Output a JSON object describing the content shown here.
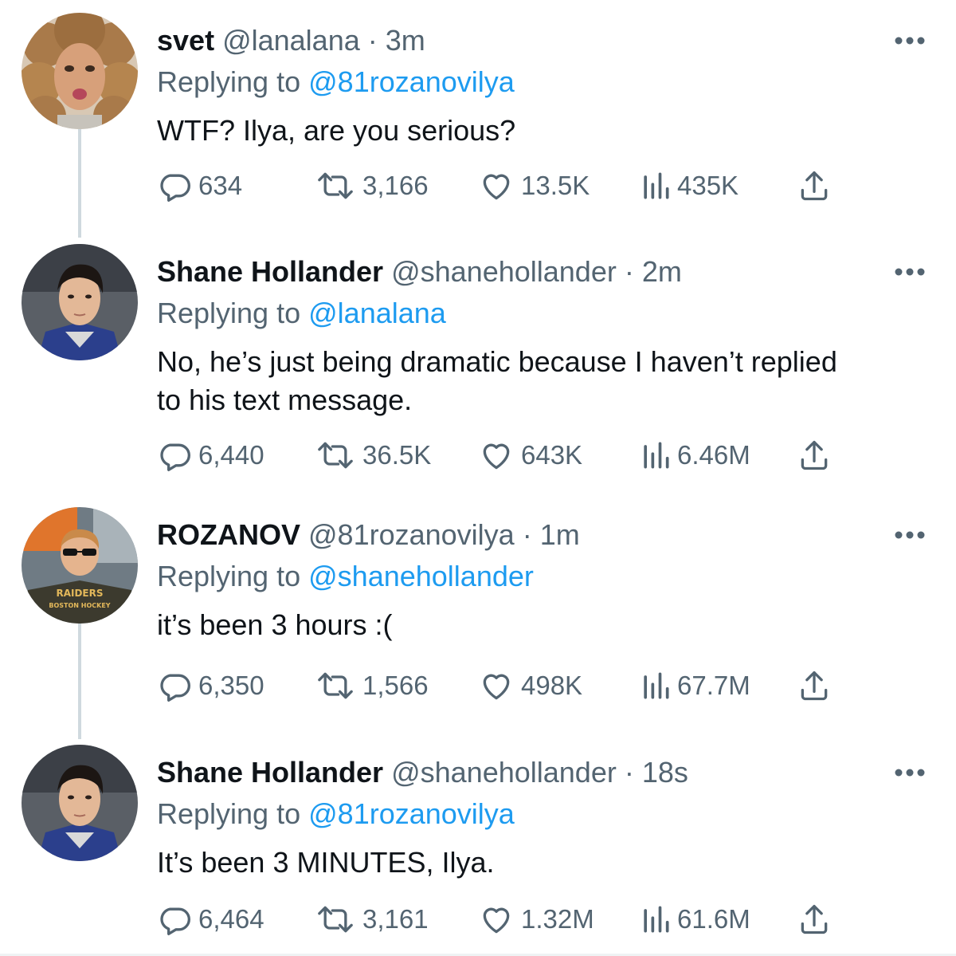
{
  "replying_prefix": "Replying to",
  "tweets": [
    {
      "name": "svet",
      "handle": "@lanalana",
      "separator": "·",
      "time": "3m",
      "replying_to": "@81rozanovilya",
      "text": "WTF? Ilya, are you serious?",
      "replies": "634",
      "retweets": "3,166",
      "likes": "13.5K",
      "views": "435K",
      "avatar": "curly-hair-woman-avatar"
    },
    {
      "name": "Shane Hollander",
      "handle": "@shanehollander",
      "separator": "·",
      "time": "2m",
      "replying_to": "@lanalana",
      "text": "No, he’s just being dramatic because I haven’t replied to his text message.",
      "replies": "6,440",
      "retweets": "36.5K",
      "likes": "643K",
      "views": "6.46M",
      "avatar": "dark-hair-man-avatar"
    },
    {
      "name": "ROZANOV",
      "handle": "@81rozanovilya",
      "separator": "·",
      "time": "1m",
      "replying_to": "@shanehollander",
      "text": "it’s been 3 hours :(",
      "replies": "6,350",
      "retweets": "1,566",
      "likes": "498K",
      "views": "67.7M",
      "avatar": "sunglasses-man-avatar",
      "avatar_shirt_text": "RAIDERS",
      "avatar_shirt_subtext": "BOSTON HOCKEY"
    },
    {
      "name": "Shane Hollander",
      "handle": "@shanehollander",
      "separator": "·",
      "time": "18s",
      "replying_to": "@81rozanovilya",
      "text": "It’s been 3 MINUTES, Ilya.",
      "replies": "6,464",
      "retweets": "3,161",
      "likes": "1.32M",
      "views": "61.6M",
      "avatar": "dark-hair-man-avatar"
    }
  ],
  "colors": {
    "text": "#0f1419",
    "secondary": "#536471",
    "link": "#1d9bf0",
    "thread_line": "#cfd9de"
  }
}
